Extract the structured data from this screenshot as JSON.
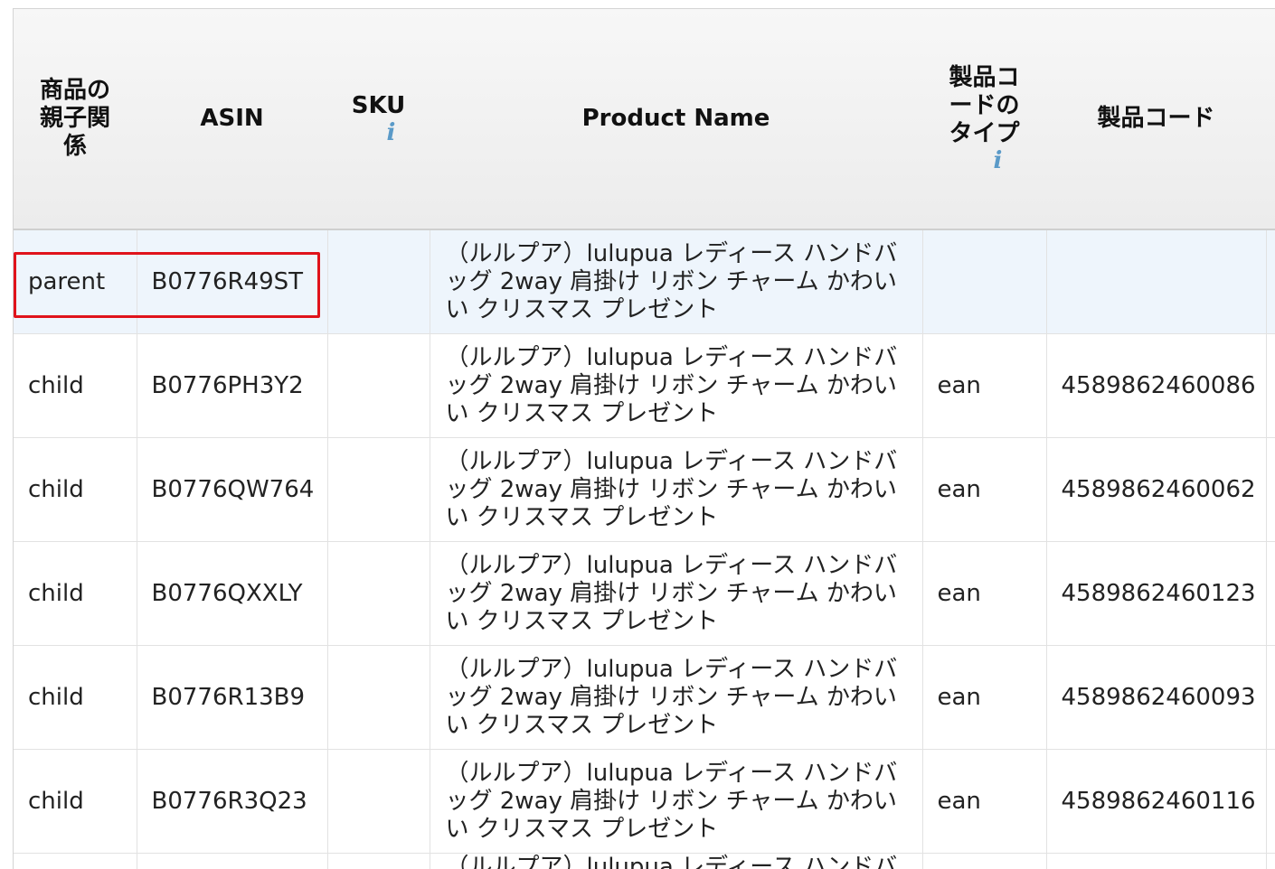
{
  "table": {
    "headers": {
      "relation": "商品の親子関係",
      "asin": "ASIN",
      "sku": "SKU",
      "sku_info_icon": "i",
      "product_name": "Product Name",
      "code_type": "製品コードのタイプ",
      "code_type_info_icon": "i",
      "product_code": "製品コード"
    },
    "rows": [
      {
        "relation": "parent",
        "asin": "B0776R49ST",
        "sku": "",
        "name": "（ルルプア）lulupua レディース ハンドバッグ 2way 肩掛け リボン チャーム かわいい クリスマス プレゼント",
        "code_type": "",
        "code": ""
      },
      {
        "relation": "child",
        "asin": "B0776PH3Y2",
        "sku": "",
        "name": "（ルルプア）lulupua レディース ハンドバッグ 2way 肩掛け リボン チャーム かわいい クリスマス プレゼント",
        "code_type": "ean",
        "code": "4589862460086"
      },
      {
        "relation": "child",
        "asin": "B0776QW764",
        "sku": "",
        "name": "（ルルプア）lulupua レディース ハンドバッグ 2way 肩掛け リボン チャーム かわいい クリスマス プレゼント",
        "code_type": "ean",
        "code": "4589862460062"
      },
      {
        "relation": "child",
        "asin": "B0776QXXLY",
        "sku": "",
        "name": "（ルルプア）lulupua レディース ハンドバッグ 2way 肩掛け リボン チャーム かわいい クリスマス プレゼント",
        "code_type": "ean",
        "code": "4589862460123"
      },
      {
        "relation": "child",
        "asin": "B0776R13B9",
        "sku": "",
        "name": "（ルルプア）lulupua レディース ハンドバッグ 2way 肩掛け リボン チャーム かわいい クリスマス プレゼント",
        "code_type": "ean",
        "code": "4589862460093"
      },
      {
        "relation": "child",
        "asin": "B0776R3Q23",
        "sku": "",
        "name": "（ルルプア）lulupua レディース ハンドバッグ 2way 肩掛け リボン チャーム かわいい クリスマス プレゼント",
        "code_type": "ean",
        "code": "4589862460116"
      },
      {
        "relation": "",
        "asin": "",
        "sku": "",
        "name": "（ルルプア）lulupua レディース ハンドバッグ",
        "code_type": "",
        "code": ""
      }
    ]
  },
  "colors": {
    "highlight_box": "#e0131b",
    "highlight_row": "#eef5fc",
    "header_bg": "#f0f0f0",
    "info_icon": "#5a9ac8"
  }
}
